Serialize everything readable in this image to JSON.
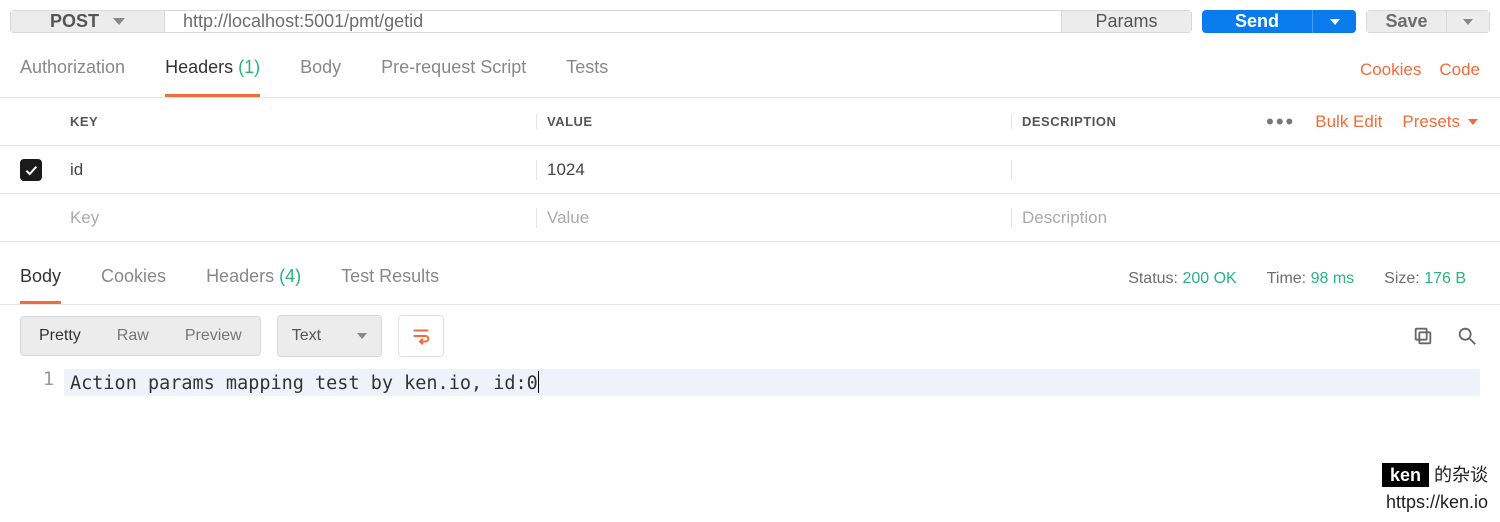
{
  "request": {
    "method": "POST",
    "url": "http://localhost:5001/pmt/getid",
    "params_btn": "Params",
    "send_btn": "Send",
    "save_btn": "Save"
  },
  "req_tabs": {
    "authorization": "Authorization",
    "headers_label": "Headers",
    "headers_count": "(1)",
    "body": "Body",
    "prerequest": "Pre-request Script",
    "tests": "Tests"
  },
  "req_links": {
    "cookies": "Cookies",
    "code": "Code"
  },
  "headers_table": {
    "col_key": "KEY",
    "col_value": "VALUE",
    "col_desc": "DESCRIPTION",
    "bulk_edit": "Bulk Edit",
    "presets": "Presets",
    "rows": [
      {
        "checked": true,
        "key": "id",
        "value": "1024",
        "desc": ""
      }
    ],
    "placeholder_key": "Key",
    "placeholder_value": "Value",
    "placeholder_desc": "Description"
  },
  "resp_tabs": {
    "body": "Body",
    "cookies": "Cookies",
    "headers_label": "Headers",
    "headers_count": "(4)",
    "test_results": "Test Results"
  },
  "resp_meta": {
    "status_label": "Status:",
    "status_value": "200 OK",
    "time_label": "Time:",
    "time_value": "98 ms",
    "size_label": "Size:",
    "size_value": "176 B"
  },
  "body_toolbar": {
    "pretty": "Pretty",
    "raw": "Raw",
    "preview": "Preview",
    "format": "Text"
  },
  "response_body": {
    "line_no": "1",
    "content": "Action params mapping test by ken.io, id:0"
  },
  "watermark": {
    "tag": "ken",
    "suffix": " 的杂谈",
    "url": "https://ken.io"
  }
}
